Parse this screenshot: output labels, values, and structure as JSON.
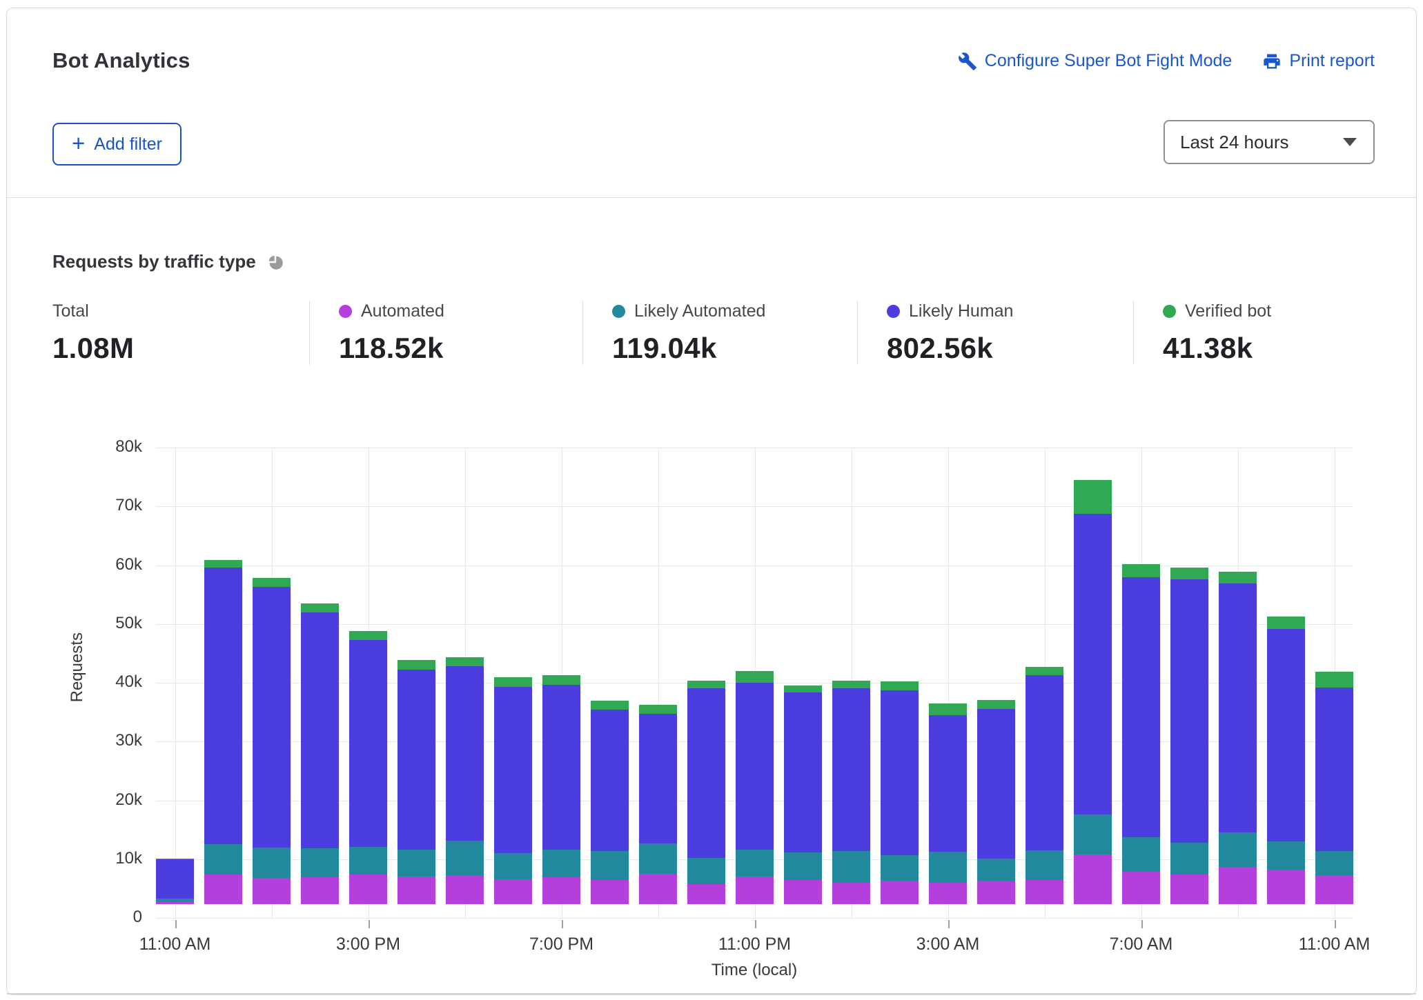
{
  "header": {
    "title": "Bot Analytics",
    "configure_link": "Configure Super Bot Fight Mode",
    "print_link": "Print report",
    "add_filter_label": "Add filter",
    "time_range_value": "Last 24 hours",
    "link_color": "#1a56cf"
  },
  "section": {
    "title": "Requests by traffic type"
  },
  "stats": [
    {
      "label": "Total",
      "value": "1.08M",
      "color": null
    },
    {
      "label": "Automated",
      "value": "118.52k",
      "color": "#b43fdd"
    },
    {
      "label": "Likely Automated",
      "value": "119.04k",
      "color": "#22899c"
    },
    {
      "label": "Likely Human",
      "value": "802.56k",
      "color": "#4c3ddf"
    },
    {
      "label": "Verified bot",
      "value": "41.38k",
      "color": "#31a854"
    }
  ],
  "chart_data": {
    "type": "bar",
    "stacked": true,
    "title": "Requests by traffic type",
    "xlabel": "Time (local)",
    "ylabel": "Requests",
    "ylim": [
      0,
      80000
    ],
    "grid": true,
    "legend_position": "top",
    "y_ticks": [
      "0",
      "10k",
      "20k",
      "30k",
      "40k",
      "50k",
      "60k",
      "70k",
      "80k"
    ],
    "x_labeled_every": 4,
    "categories": [
      "11:00 AM",
      "12:00 PM",
      "1:00 PM",
      "2:00 PM",
      "3:00 PM",
      "4:00 PM",
      "5:00 PM",
      "6:00 PM",
      "7:00 PM",
      "8:00 PM",
      "9:00 PM",
      "10:00 PM",
      "11:00 PM",
      "12:00 AM",
      "1:00 AM",
      "2:00 AM",
      "3:00 AM",
      "4:00 AM",
      "5:00 AM",
      "6:00 AM",
      "7:00 AM",
      "8:00 AM",
      "9:00 AM",
      "10:00 AM",
      "11:00 AM"
    ],
    "series": [
      {
        "name": "Automated",
        "color": "#b43fdd",
        "values": [
          400,
          5000,
          4500,
          4600,
          5000,
          4700,
          4900,
          4200,
          4600,
          4100,
          5200,
          3400,
          4700,
          4100,
          3700,
          4000,
          3700,
          3900,
          4100,
          8400,
          5500,
          5100,
          6300,
          5800,
          4800
        ]
      },
      {
        "name": "Likely Automated",
        "color": "#22899c",
        "values": [
          600,
          5200,
          5100,
          4900,
          4700,
          4600,
          5900,
          4500,
          4700,
          4900,
          5100,
          4500,
          4600,
          4700,
          5400,
          4300,
          5200,
          3900,
          5100,
          6800,
          5900,
          5400,
          5900,
          4900,
          4200
        ]
      },
      {
        "name": "Likely Human",
        "color": "#4c3ddf",
        "values": [
          6600,
          47100,
          44400,
          40100,
          35200,
          30600,
          29700,
          28300,
          28000,
          24100,
          22100,
          28800,
          28400,
          27200,
          27600,
          28100,
          23200,
          25400,
          29700,
          51200,
          44200,
          44700,
          42400,
          36100,
          27900
        ]
      },
      {
        "name": "Verified bot",
        "color": "#31a854",
        "values": [
          200,
          1300,
          1500,
          1600,
          1500,
          1600,
          1500,
          1600,
          1600,
          1500,
          1500,
          1300,
          1900,
          1200,
          1300,
          1500,
          2100,
          1500,
          1500,
          5800,
          2200,
          2000,
          1900,
          2100,
          2700
        ]
      }
    ]
  }
}
